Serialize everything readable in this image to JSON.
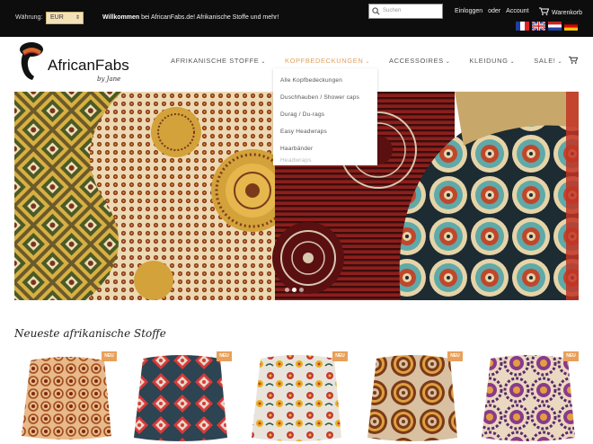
{
  "topbar": {
    "currency_label": "Währung:",
    "currency_value": "EUR",
    "welcome_bold": "Willkommen",
    "welcome_text": " bei AfricanFabs.de! Afrikanische Stoffe und mehr!",
    "search_placeholder": "Suchen",
    "login": "Einloggen",
    "or": "oder",
    "account": "Account",
    "cart": "Warenkorb",
    "flags": [
      "french-flag",
      "uk-flag",
      "dutch-flag",
      "german-flag"
    ]
  },
  "logo": {
    "name": "AfricanFabs",
    "tagline": "by Jane"
  },
  "nav": {
    "items": [
      {
        "label": "AFRIKANISCHE STOFFE"
      },
      {
        "label": "KOPFBEDECKUNGEN"
      },
      {
        "label": "ACCESSOIRES"
      },
      {
        "label": "KLEIDUNG"
      },
      {
        "label": "SALE!"
      }
    ]
  },
  "dropdown": {
    "items": [
      "Alle Kopfbedeckungen",
      "Duschhauben / Shower caps",
      "Durag / Du-rags",
      "Easy Headwraps",
      "Haarbänder",
      "Headwraps"
    ]
  },
  "section": {
    "title": "Neueste afrikanische Stoffe"
  },
  "badge": "NEU",
  "colors": {
    "accent": "#e0a060",
    "badge": "#e8a05a",
    "topbar": "#0d0d0d"
  }
}
